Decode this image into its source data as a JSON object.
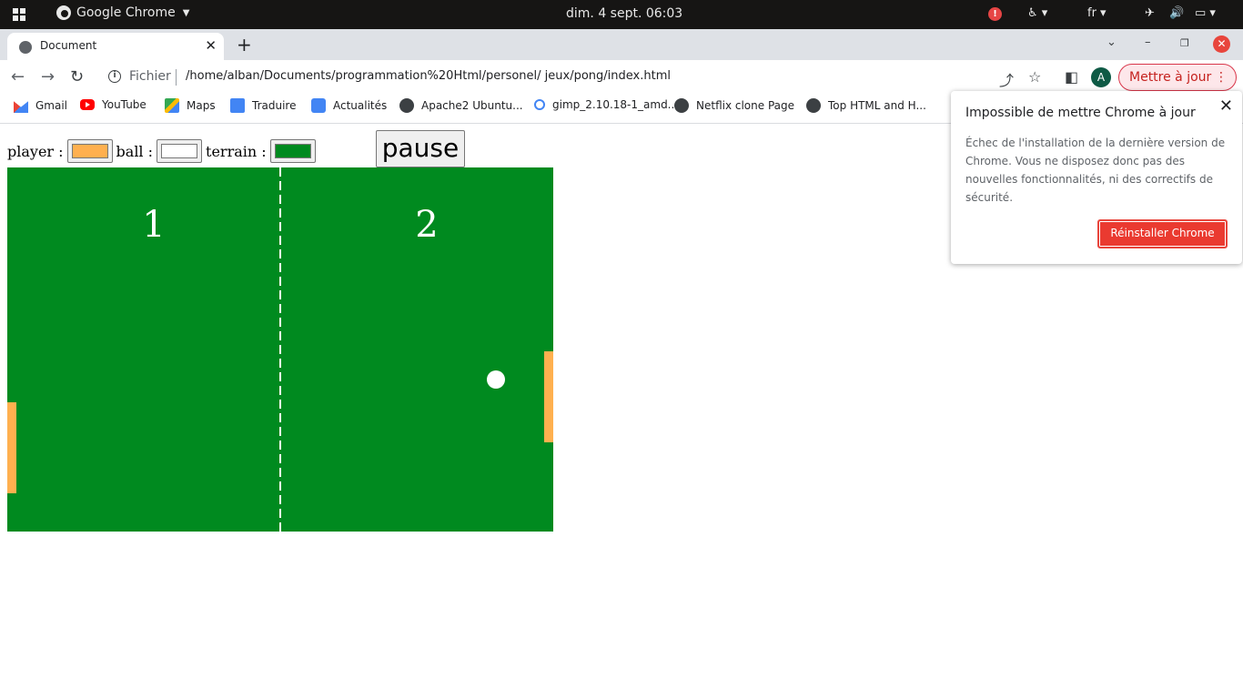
{
  "os": {
    "app_name": "Google Chrome",
    "clock": "dim. 4 sept. 06:03",
    "language": "fr",
    "alert_badge": "!"
  },
  "browser": {
    "tab_title": "Document",
    "scheme_label": "Fichier",
    "url": "/home/alban/Documents/programmation%20Html/personel/ jeux/pong/index.html",
    "profile_initial": "A",
    "update_button": "Mettre à jour"
  },
  "bookmarks": [
    {
      "label": "Gmail",
      "icon": "gmail-icon"
    },
    {
      "label": "YouTube",
      "icon": "youtube-icon"
    },
    {
      "label": "Maps",
      "icon": "maps-icon"
    },
    {
      "label": "Traduire",
      "icon": "translate-icon"
    },
    {
      "label": "Actualités",
      "icon": "news-icon"
    },
    {
      "label": "Apache2 Ubuntu...",
      "icon": "globe-icon"
    },
    {
      "label": "gimp_2.10.18-1_amd...",
      "icon": "search-icon"
    },
    {
      "label": "Netflix clone Page",
      "icon": "globe-icon"
    },
    {
      "label": "Top HTML and H...",
      "icon": "globe-icon"
    }
  ],
  "game": {
    "player_label": "player :",
    "ball_label": "ball :",
    "terrain_label": "terrain :",
    "pause_label": "pause",
    "score_left": "1",
    "score_right": "2",
    "colors": {
      "player": "#ffb04f",
      "ball": "#ffffff",
      "terrain": "#008a1f"
    }
  },
  "popup": {
    "title": "Impossible de mettre Chrome à jour",
    "body": "Échec de l'installation de la dernière version de Chrome. Vous ne disposez donc pas des nouvelles fonctionnalités, ni des correctifs de sécurité.",
    "button": "Réinstaller Chrome"
  }
}
